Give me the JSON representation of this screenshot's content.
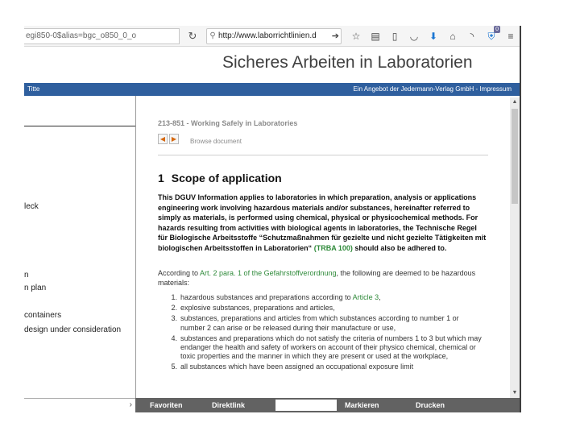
{
  "browser": {
    "url_left": "egi850-0$alias=bgc_o850_0_o",
    "url_main": "http://www.laborrichtlinien.d",
    "badge": "0"
  },
  "site": {
    "title": "Sicheres Arbeiten in Laboratorien",
    "bar_tab": "Titte",
    "bar_right": "Ein Angebot der Jedermann-Verlag GmbH - Impressum"
  },
  "left": {
    "items": [
      "leck",
      "n",
      "n plan",
      "containers",
      "design under consideration"
    ]
  },
  "document": {
    "header": "213-851 - Working Safely in Laboratories",
    "browse_label": "Browse document",
    "section_number": "1",
    "section_title": "Scope of application",
    "lead_text": "This DGUV Information applies to laboratories in which preparation, analysis or applications engineering work involving hazardous materials and/or substances, hereinafter referred to simply as materials, is performed using chemical, physical or physicochemical methods. For hazards resulting from activities with biological agents in laboratories, the Technische Regel für Biologische Arbeitsstoffe “Schutzmaßnahmen für gezielte und nicht gezielte Tätigkeiten mit biologischen Arbeitsstoffen in Laboratorien“",
    "lead_link": "(TRBA 100)",
    "lead_tail": " should also be adhered to.",
    "intro_pre": "According to ",
    "intro_link": "Art. 2 para. 1 of the Gefahrstoffverordnung",
    "intro_post": ", the following are deemed to be hazardous materials:",
    "list": [
      {
        "num": "1.",
        "text": "hazardous substances and preparations according to ",
        "link": "Article 3",
        "tail": ","
      },
      {
        "num": "2.",
        "text": "explosive substances, preparations and articles,",
        "link": "",
        "tail": ""
      },
      {
        "num": "3.",
        "text": "substances, preparations and articles from which substances according to number 1 or number 2 can arise or be released during their manufacture or use,",
        "link": "",
        "tail": ""
      },
      {
        "num": "4.",
        "text": "substances and preparations which do not satisfy the criteria of numbers 1 to 3 but which may endanger the health and safety of workers on account of their physico chemical, chemical or toxic properties and the manner in which they are present or used at the workplace,",
        "link": "",
        "tail": ""
      },
      {
        "num": "5.",
        "text": "all substances which have been assigned an occupational exposure limit",
        "link": "",
        "tail": ""
      }
    ]
  },
  "bottom_bar": {
    "favoriten": "Favoriten",
    "direktlink": "Direktlink",
    "markieren": "Markieren",
    "drucken": "Drucken"
  }
}
